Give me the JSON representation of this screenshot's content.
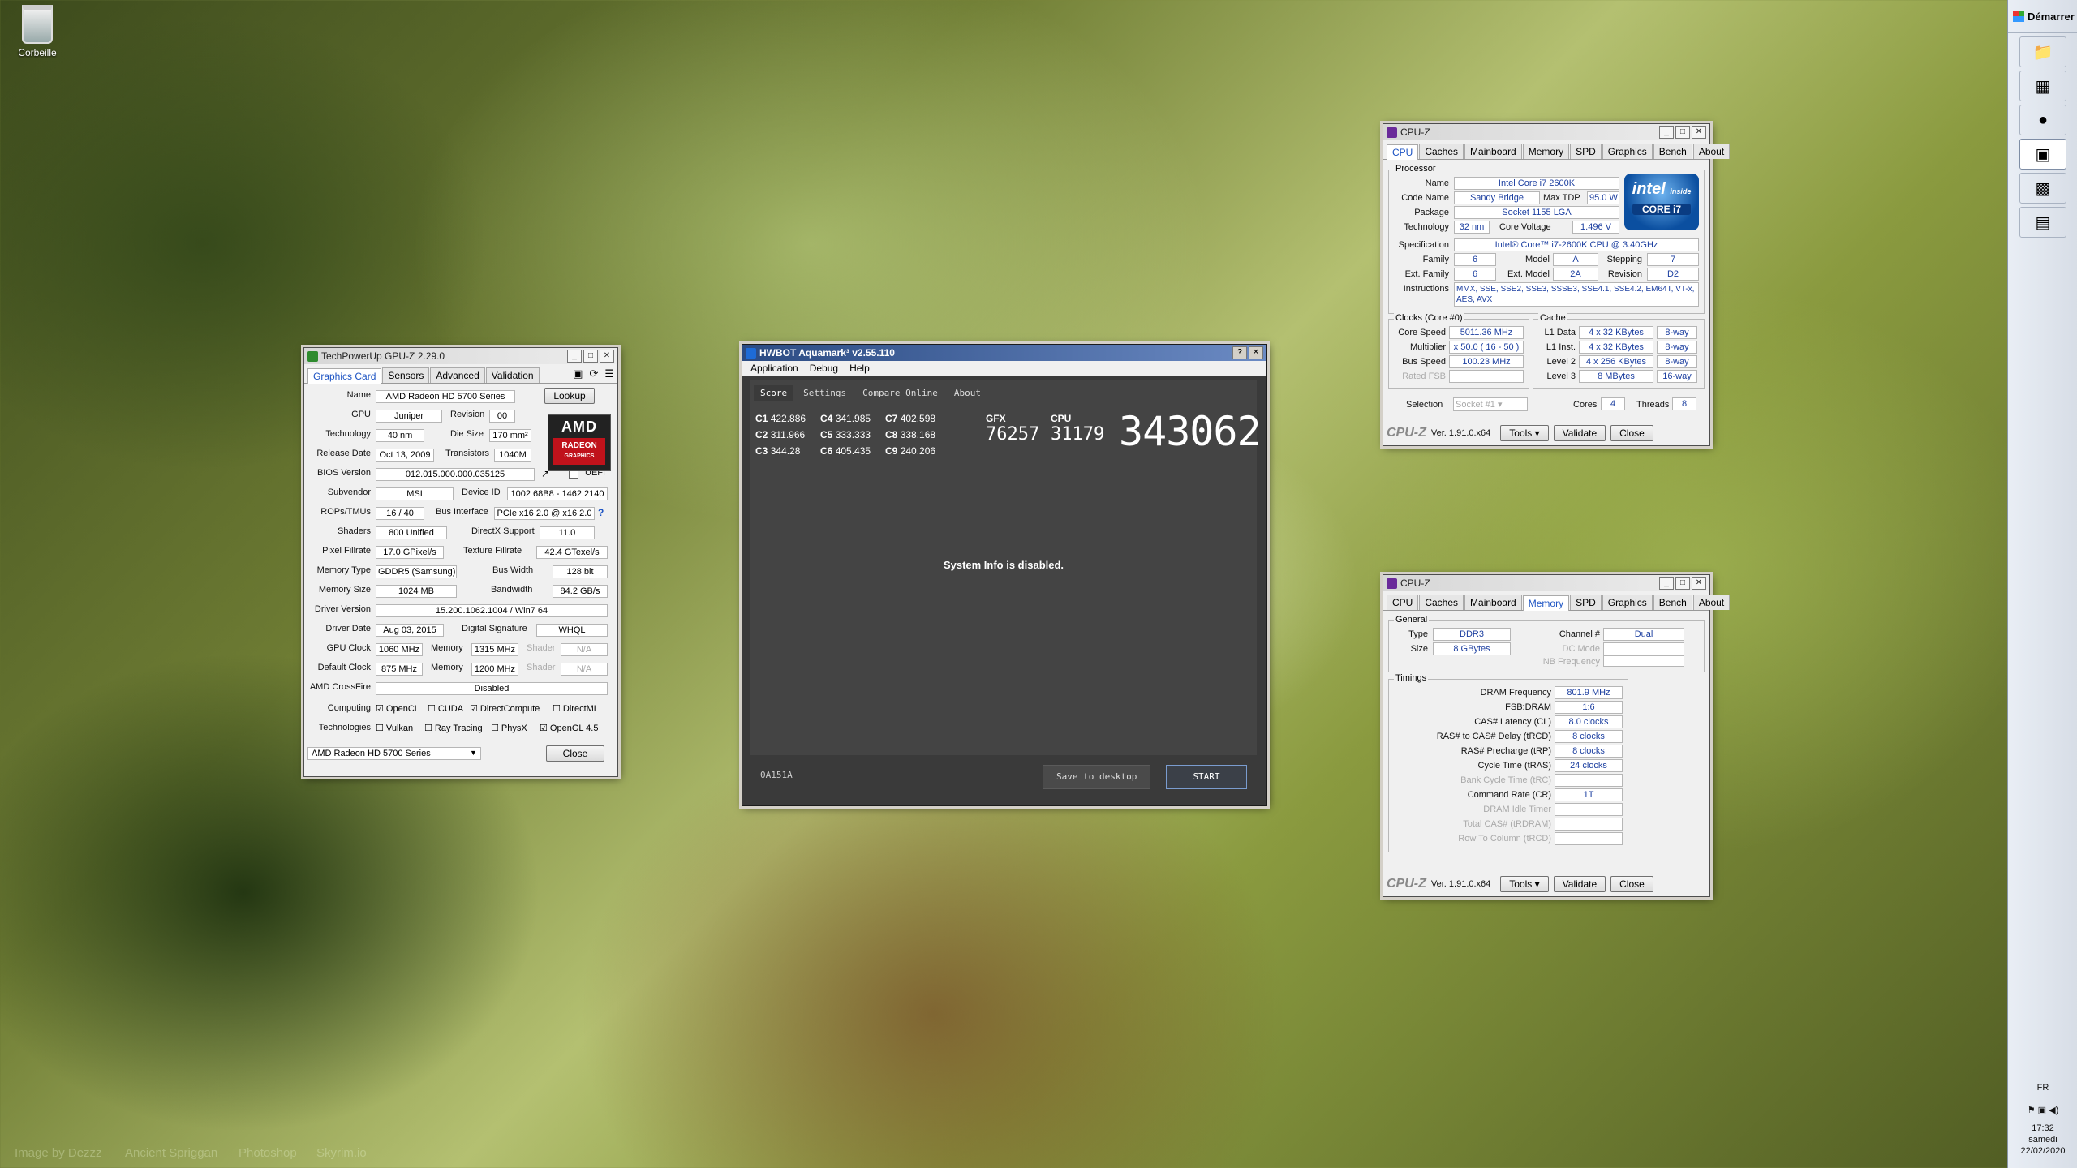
{
  "desktop": {
    "recycle_bin": "Corbeille",
    "credits": [
      "Image by Dezzz",
      "Ancient Spriggan",
      "Photoshop",
      "Skyrim.io"
    ]
  },
  "taskbar": {
    "start": "Démarrer",
    "lang": "FR",
    "time": "17:32",
    "day": "samedi",
    "date": "22/02/2020"
  },
  "gpuz": {
    "title": "TechPowerUp GPU-Z 2.29.0",
    "tabs": [
      "Graphics Card",
      "Sensors",
      "Advanced",
      "Validation"
    ],
    "lookup": "Lookup",
    "name": "AMD Radeon HD 5700 Series",
    "gpu": "Juniper",
    "revision_label": "Revision",
    "revision": "00",
    "technology": "40 nm",
    "die_size_label": "Die Size",
    "die_size": "170 mm²",
    "release_date": "Oct 13, 2009",
    "transistors_label": "Transistors",
    "transistors": "1040M",
    "bios": "012.015.000.000.035125",
    "uefi": "UEFI",
    "subvendor": "MSI",
    "device_id_label": "Device ID",
    "device_id": "1002 68B8 - 1462 2140",
    "rops": "16 / 40",
    "bus_label": "Bus Interface",
    "bus": "PCIe x16 2.0 @ x16 2.0",
    "shaders": "800 Unified",
    "directx_label": "DirectX Support",
    "directx": "11.0",
    "pixel_fillrate": "17.0 GPixel/s",
    "texture_label": "Texture Fillrate",
    "texture_fillrate": "42.4 GTexel/s",
    "memory_type": "GDDR5 (Samsung)",
    "bus_width_label": "Bus Width",
    "bus_width": "128 bit",
    "memory_size": "1024 MB",
    "bandwidth_label": "Bandwidth",
    "bandwidth": "84.2 GB/s",
    "driver_version": "15.200.1062.1004 / Win7 64",
    "driver_date": "Aug 03, 2015",
    "dsig_label": "Digital Signature",
    "dsig": "WHQL",
    "gpu_clock": "1060 MHz",
    "mem_label": "Memory",
    "gpu_mem": "1315 MHz",
    "shader_label": "Shader",
    "shader_na": "N/A",
    "default_clock": "875 MHz",
    "default_mem": "1200 MHz",
    "crossfire": "Disabled",
    "labels": {
      "name": "Name",
      "gpu": "GPU",
      "technology": "Technology",
      "release": "Release Date",
      "bios": "BIOS Version",
      "subvendor": "Subvendor",
      "rops": "ROPs/TMUs",
      "shaders": "Shaders",
      "pixel": "Pixel Fillrate",
      "memtype": "Memory Type",
      "memsize": "Memory Size",
      "driver": "Driver Version",
      "driverdate": "Driver Date",
      "gpuclock": "GPU Clock",
      "defclock": "Default Clock",
      "crossfire": "AMD CrossFire",
      "computing": "Computing",
      "technologies": "Technologies"
    },
    "computing": [
      "OpenCL",
      "CUDA",
      "DirectCompute",
      "DirectML"
    ],
    "computing_checked": [
      true,
      false,
      true,
      false
    ],
    "technologies": [
      "Vulkan",
      "Ray Tracing",
      "PhysX",
      "OpenGL 4.5"
    ],
    "technologies_checked": [
      false,
      false,
      false,
      true
    ],
    "select": "AMD Radeon HD 5700 Series",
    "close": "Close",
    "amd": "AMD",
    "radeon": "RADEON",
    "graphics": "GRAPHICS"
  },
  "aquamark": {
    "title": "HWBOT Aquamark³ v2.55.110",
    "menu": [
      "Application",
      "Debug",
      "Help"
    ],
    "tabs": [
      "Score",
      "Settings",
      "Compare Online",
      "About"
    ],
    "scores": [
      {
        "k": "C1",
        "v": "422.886"
      },
      {
        "k": "C4",
        "v": "341.985"
      },
      {
        "k": "C7",
        "v": "402.598"
      },
      {
        "k": "C2",
        "v": "311.966"
      },
      {
        "k": "C5",
        "v": "333.333"
      },
      {
        "k": "C8",
        "v": "338.168"
      },
      {
        "k": "C3",
        "v": "344.28"
      },
      {
        "k": "C6",
        "v": "405.435"
      },
      {
        "k": "C9",
        "v": "240.206"
      }
    ],
    "gfx_label": "GFX",
    "gfx": "76257",
    "cpu_label": "CPU",
    "cpu": "31179",
    "total": "343062",
    "sysinfo": "System Info is disabled.",
    "code": "0A151A",
    "save": "Save to desktop",
    "start": "START"
  },
  "cpuz1": {
    "title": "CPU-Z",
    "tabs": [
      "CPU",
      "Caches",
      "Mainboard",
      "Memory",
      "SPD",
      "Graphics",
      "Bench",
      "About"
    ],
    "processor": "Processor",
    "name_l": "Name",
    "name": "Intel Core i7 2600K",
    "codename_l": "Code Name",
    "codename": "Sandy Bridge",
    "maxtdp_l": "Max TDP",
    "maxtdp": "95.0 W",
    "package_l": "Package",
    "package": "Socket 1155 LGA",
    "tech_l": "Technology",
    "tech": "32 nm",
    "cv_l": "Core Voltage",
    "cv": "1.496 V",
    "spec_l": "Specification",
    "spec": "Intel® Core™ i7-2600K CPU @ 3.40GHz",
    "family_l": "Family",
    "family": "6",
    "model_l": "Model",
    "model": "A",
    "stepping_l": "Stepping",
    "stepping": "7",
    "extfam_l": "Ext. Family",
    "extfam": "6",
    "extmod_l": "Ext. Model",
    "extmod": "2A",
    "rev_l": "Revision",
    "rev": "D2",
    "instr_l": "Instructions",
    "instr": "MMX, SSE, SSE2, SSE3, SSSE3, SSE4.1, SSE4.2, EM64T, VT-x, AES, AVX",
    "clocks": "Clocks (Core #0)",
    "corespeed_l": "Core Speed",
    "corespeed": "5011.36 MHz",
    "mult_l": "Multiplier",
    "mult": "x 50.0 ( 16 - 50 )",
    "bus_l": "Bus Speed",
    "bus": "100.23 MHz",
    "fsb_l": "Rated FSB",
    "cache": "Cache",
    "l1d_l": "L1 Data",
    "l1d": "4 x 32 KBytes",
    "l1d_w": "8-way",
    "l1i_l": "L1 Inst.",
    "l1i": "4 x 32 KBytes",
    "l1i_w": "8-way",
    "l2_l": "Level 2",
    "l2": "4 x 256 KBytes",
    "l2_w": "8-way",
    "l3_l": "Level 3",
    "l3": "8 MBytes",
    "l3_w": "16-way",
    "sel_l": "Selection",
    "sel": "Socket #1",
    "cores_l": "Cores",
    "cores": "4",
    "threads_l": "Threads",
    "threads": "8",
    "brand": "CPU-Z",
    "ver": "Ver. 1.91.0.x64",
    "tools": "Tools",
    "validate": "Validate",
    "close": "Close",
    "intel": "intel",
    "inside": "inside",
    "corei7": "CORE i7"
  },
  "cpuz2": {
    "title": "CPU-Z",
    "tabs": [
      "CPU",
      "Caches",
      "Mainboard",
      "Memory",
      "SPD",
      "Graphics",
      "Bench",
      "About"
    ],
    "general": "General",
    "type_l": "Type",
    "type": "DDR3",
    "channel_l": "Channel #",
    "channel": "Dual",
    "size_l": "Size",
    "size": "8 GBytes",
    "dcmode_l": "DC Mode",
    "nbfreq_l": "NB Frequency",
    "timings": "Timings",
    "rows": [
      {
        "l": "DRAM Frequency",
        "v": "801.9 MHz",
        "dim": false
      },
      {
        "l": "FSB:DRAM",
        "v": "1:6",
        "dim": false
      },
      {
        "l": "CAS# Latency (CL)",
        "v": "8.0 clocks",
        "dim": false
      },
      {
        "l": "RAS# to CAS# Delay (tRCD)",
        "v": "8 clocks",
        "dim": false
      },
      {
        "l": "RAS# Precharge (tRP)",
        "v": "8 clocks",
        "dim": false
      },
      {
        "l": "Cycle Time (tRAS)",
        "v": "24 clocks",
        "dim": false
      },
      {
        "l": "Bank Cycle Time (tRC)",
        "v": "",
        "dim": true
      },
      {
        "l": "Command Rate (CR)",
        "v": "1T",
        "dim": false
      },
      {
        "l": "DRAM Idle Timer",
        "v": "",
        "dim": true
      },
      {
        "l": "Total CAS# (tRDRAM)",
        "v": "",
        "dim": true
      },
      {
        "l": "Row To Column (tRCD)",
        "v": "",
        "dim": true
      }
    ],
    "brand": "CPU-Z",
    "ver": "Ver. 1.91.0.x64",
    "tools": "Tools",
    "validate": "Validate",
    "close": "Close"
  },
  "colors": {
    "aqua_title": "#2b4b83",
    "aqua_bg": "#3a3a3a",
    "cpuz_active_tab": "#1c53c3",
    "amd_red": "#c0121b",
    "intel_blue": "#0b4fa0"
  }
}
